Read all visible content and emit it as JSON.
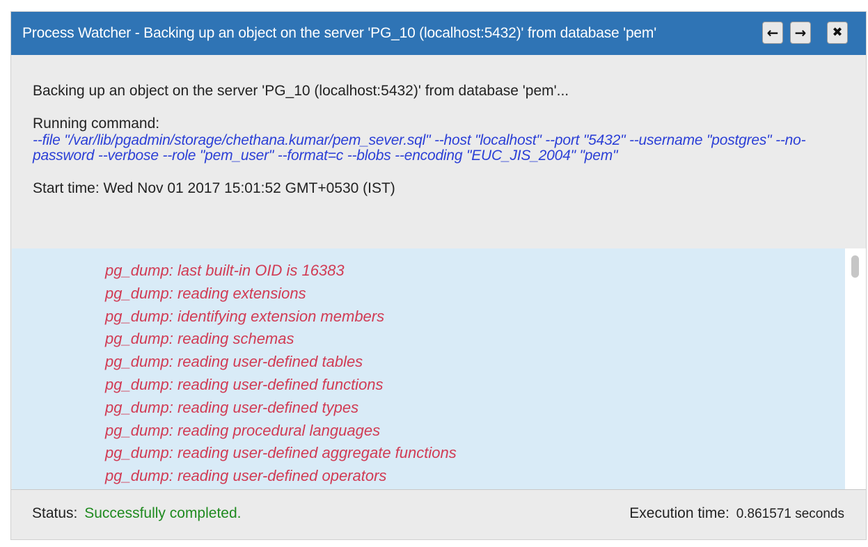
{
  "window": {
    "title": "Process Watcher - Backing up an object on the server 'PG_10 (localhost:5432)' from database 'pem'",
    "prev_icon": "arrow-left-icon",
    "next_icon": "arrow-right-icon",
    "close_icon": "close-icon",
    "title_bar_color": "#2f74b5"
  },
  "process": {
    "description": "Backing up an object on the server 'PG_10 (localhost:5432)' from database 'pem'...",
    "command_label": "Running command:",
    "command": "--file \"/var/lib/pgadmin/storage/chethana.kumar/pem_sever.sql\" --host \"localhost\" --port \"5432\" --username \"postgres\" --no-password --verbose --role \"pem_user\" --format=c --blobs --encoding \"EUC_JIS_2004\" \"pem\"",
    "start_time": "Start time: Wed Nov 01 2017 15:01:52 GMT+0530 (IST)"
  },
  "log": {
    "lines": [
      "pg_dump: last built-in OID is 16383",
      "pg_dump: reading extensions",
      "pg_dump: identifying extension members",
      "pg_dump: reading schemas",
      "pg_dump: reading user-defined tables",
      "pg_dump: reading user-defined functions",
      "pg_dump: reading user-defined types",
      "pg_dump: reading procedural languages",
      "pg_dump: reading user-defined aggregate functions",
      "pg_dump: reading user-defined operators"
    ],
    "text_color": "#d13b54",
    "background_color": "#d9ebf7"
  },
  "footer": {
    "status_label": "Status:",
    "status_value": "Successfully completed.",
    "status_color": "#1f8a1f",
    "exec_label": "Execution time:",
    "exec_value": "0.861571 seconds"
  }
}
